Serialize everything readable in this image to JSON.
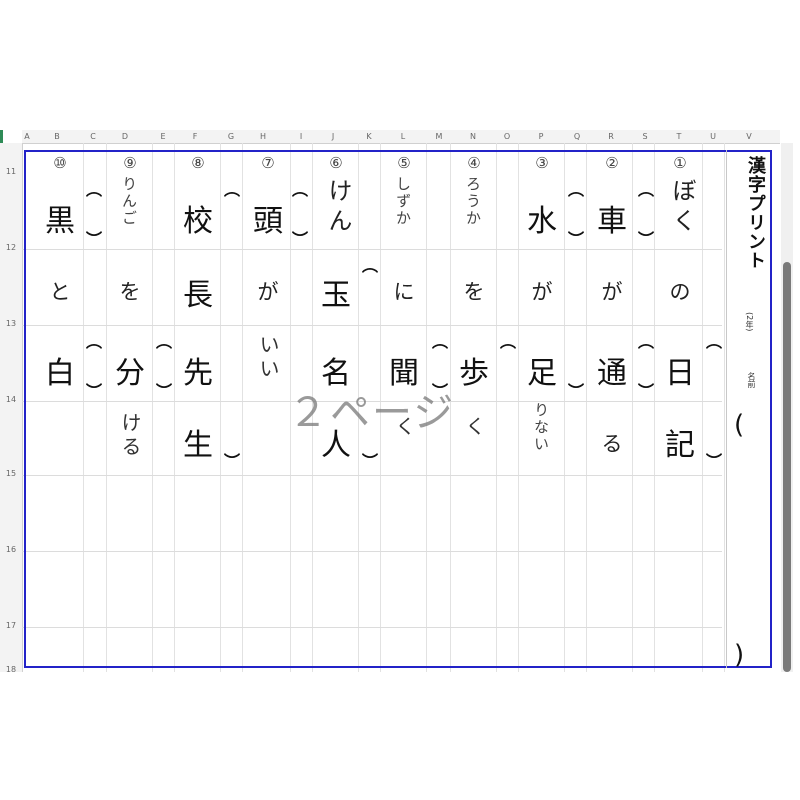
{
  "columns": [
    "A",
    "B",
    "C",
    "D",
    "E",
    "F",
    "G",
    "H",
    "I",
    "J",
    "K",
    "L",
    "M",
    "N",
    "O",
    "P",
    "Q",
    "R",
    "S",
    "T",
    "U",
    "V"
  ],
  "rows": [
    "11",
    "12",
    "13",
    "14",
    "15",
    "16",
    "17",
    "18"
  ],
  "title": "漢字プリント",
  "grade": "(2年)",
  "name_label": "名前",
  "name_open": "(",
  "name_close": ")",
  "watermark": "２ページ",
  "questions": [
    {
      "num": "①",
      "top": "ぼく",
      "mid": "の",
      "bottom": "日",
      "last": "記"
    },
    {
      "num": "②",
      "top": "車",
      "mid": "が",
      "bottom": "通",
      "last": "る"
    },
    {
      "num": "③",
      "top": "水",
      "mid": "が",
      "bottom": "足",
      "last": "りない"
    },
    {
      "num": "④",
      "top": "ろうか",
      "mid": "を",
      "bottom": "歩",
      "last": "く"
    },
    {
      "num": "⑤",
      "top": "しずか",
      "mid": "に",
      "bottom": "聞",
      "last": "く"
    },
    {
      "num": "⑥",
      "top": "けん",
      "mid": "玉",
      "bottom": "名",
      "last": "人"
    },
    {
      "num": "⑦",
      "top": "頭",
      "mid": "が",
      "bottom": "いい",
      "last": ""
    },
    {
      "num": "⑧",
      "top": "校",
      "mid": "長",
      "bottom": "先",
      "last": "生"
    },
    {
      "num": "⑨",
      "top": "りんご",
      "mid": "を",
      "bottom": "分",
      "last": "ける"
    },
    {
      "num": "⑩",
      "top": "黒",
      "mid": "と",
      "bottom": "白",
      "last": ""
    }
  ]
}
